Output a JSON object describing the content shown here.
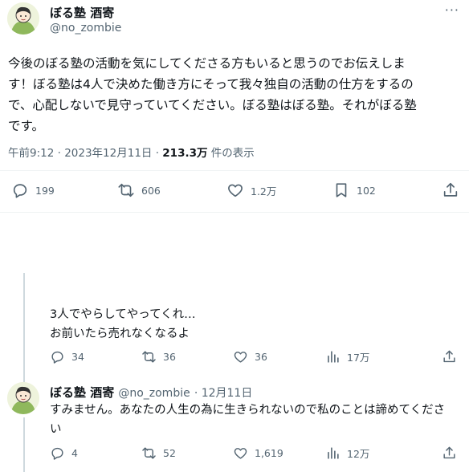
{
  "main_tweet": {
    "author_name": "ぼる塾 酒寄",
    "author_handle": "@no_zombie",
    "more_label": "···",
    "text_lines": [
      "今後のぼる塾の活動を気にしてくださる方もいると思うのでお伝えしま",
      "す！ぼる塾は4人で決めた働き方にそって我々独自の活動の仕方をするの",
      "で、心配しないで見守っていてください。ぼる塾はぼる塾。それがぼる塾",
      "です。"
    ],
    "timestamp": "午前9:12 · 2023年12月11日 · ",
    "views_count": "213.3万",
    "views_suffix": " 件の表示",
    "stats": {
      "replies": "199",
      "retweets": "606",
      "likes": "1.2万",
      "bookmarks": "102"
    }
  },
  "reply_1": {
    "text_lines": [
      "3人でやらしてやってくれ…",
      "お前いたら売れなくなるよ"
    ],
    "stats": {
      "replies": "34",
      "retweets": "36",
      "likes": "36",
      "views": "17万"
    }
  },
  "reply_2": {
    "author_name": "ぼる塾 酒寄",
    "author_handle": "@no_zombie",
    "date": "· 12月11日",
    "text_lines": [
      "すみません。あなたの人生の為に生きられないので私のことは諦めてくださ",
      "い"
    ],
    "stats": {
      "replies": "4",
      "retweets": "52",
      "likes": "1,619",
      "views": "12万"
    }
  },
  "colors": {
    "text": "#0f1419",
    "secondary": "#536471",
    "divider": "#eff3f4",
    "thread": "#cfd9de"
  },
  "icons": [
    "reply-icon",
    "retweet-icon",
    "like-icon",
    "bookmark-icon",
    "views-icon",
    "share-icon",
    "more-icon"
  ]
}
